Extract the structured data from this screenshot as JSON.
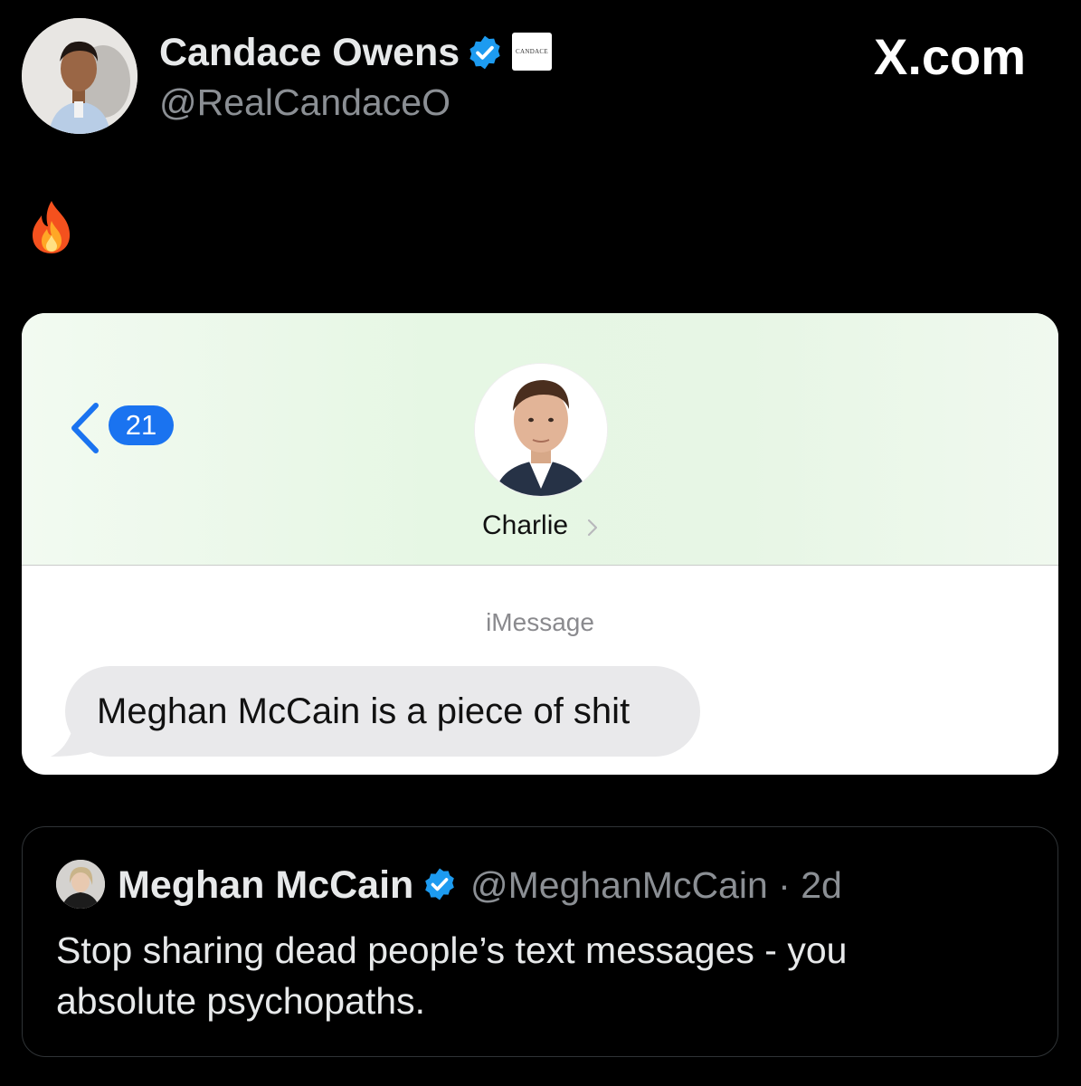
{
  "post": {
    "author_name": "Candace Owens",
    "author_handle": "@RealCandaceO",
    "affiliation_badge": "CANDACE",
    "brand": "X.com",
    "body_emoji": "fire-emoji"
  },
  "screenshot": {
    "unread_count": "21",
    "contact_name": "Charlie",
    "service_label": "iMessage",
    "message_text": "Meghan McCain is a piece of shit"
  },
  "quoted": {
    "author_name": "Meghan McCain",
    "handle_time": "@MeghanMcCain · 2d",
    "text_lines": [
      "Stop sharing dead people’s text messages - you",
      "absolute psychopaths."
    ]
  },
  "colors": {
    "background": "#000000",
    "verified": "#1d9bf0",
    "imessage_blue": "#1a73f0",
    "bubble": "#e9e9eb"
  }
}
